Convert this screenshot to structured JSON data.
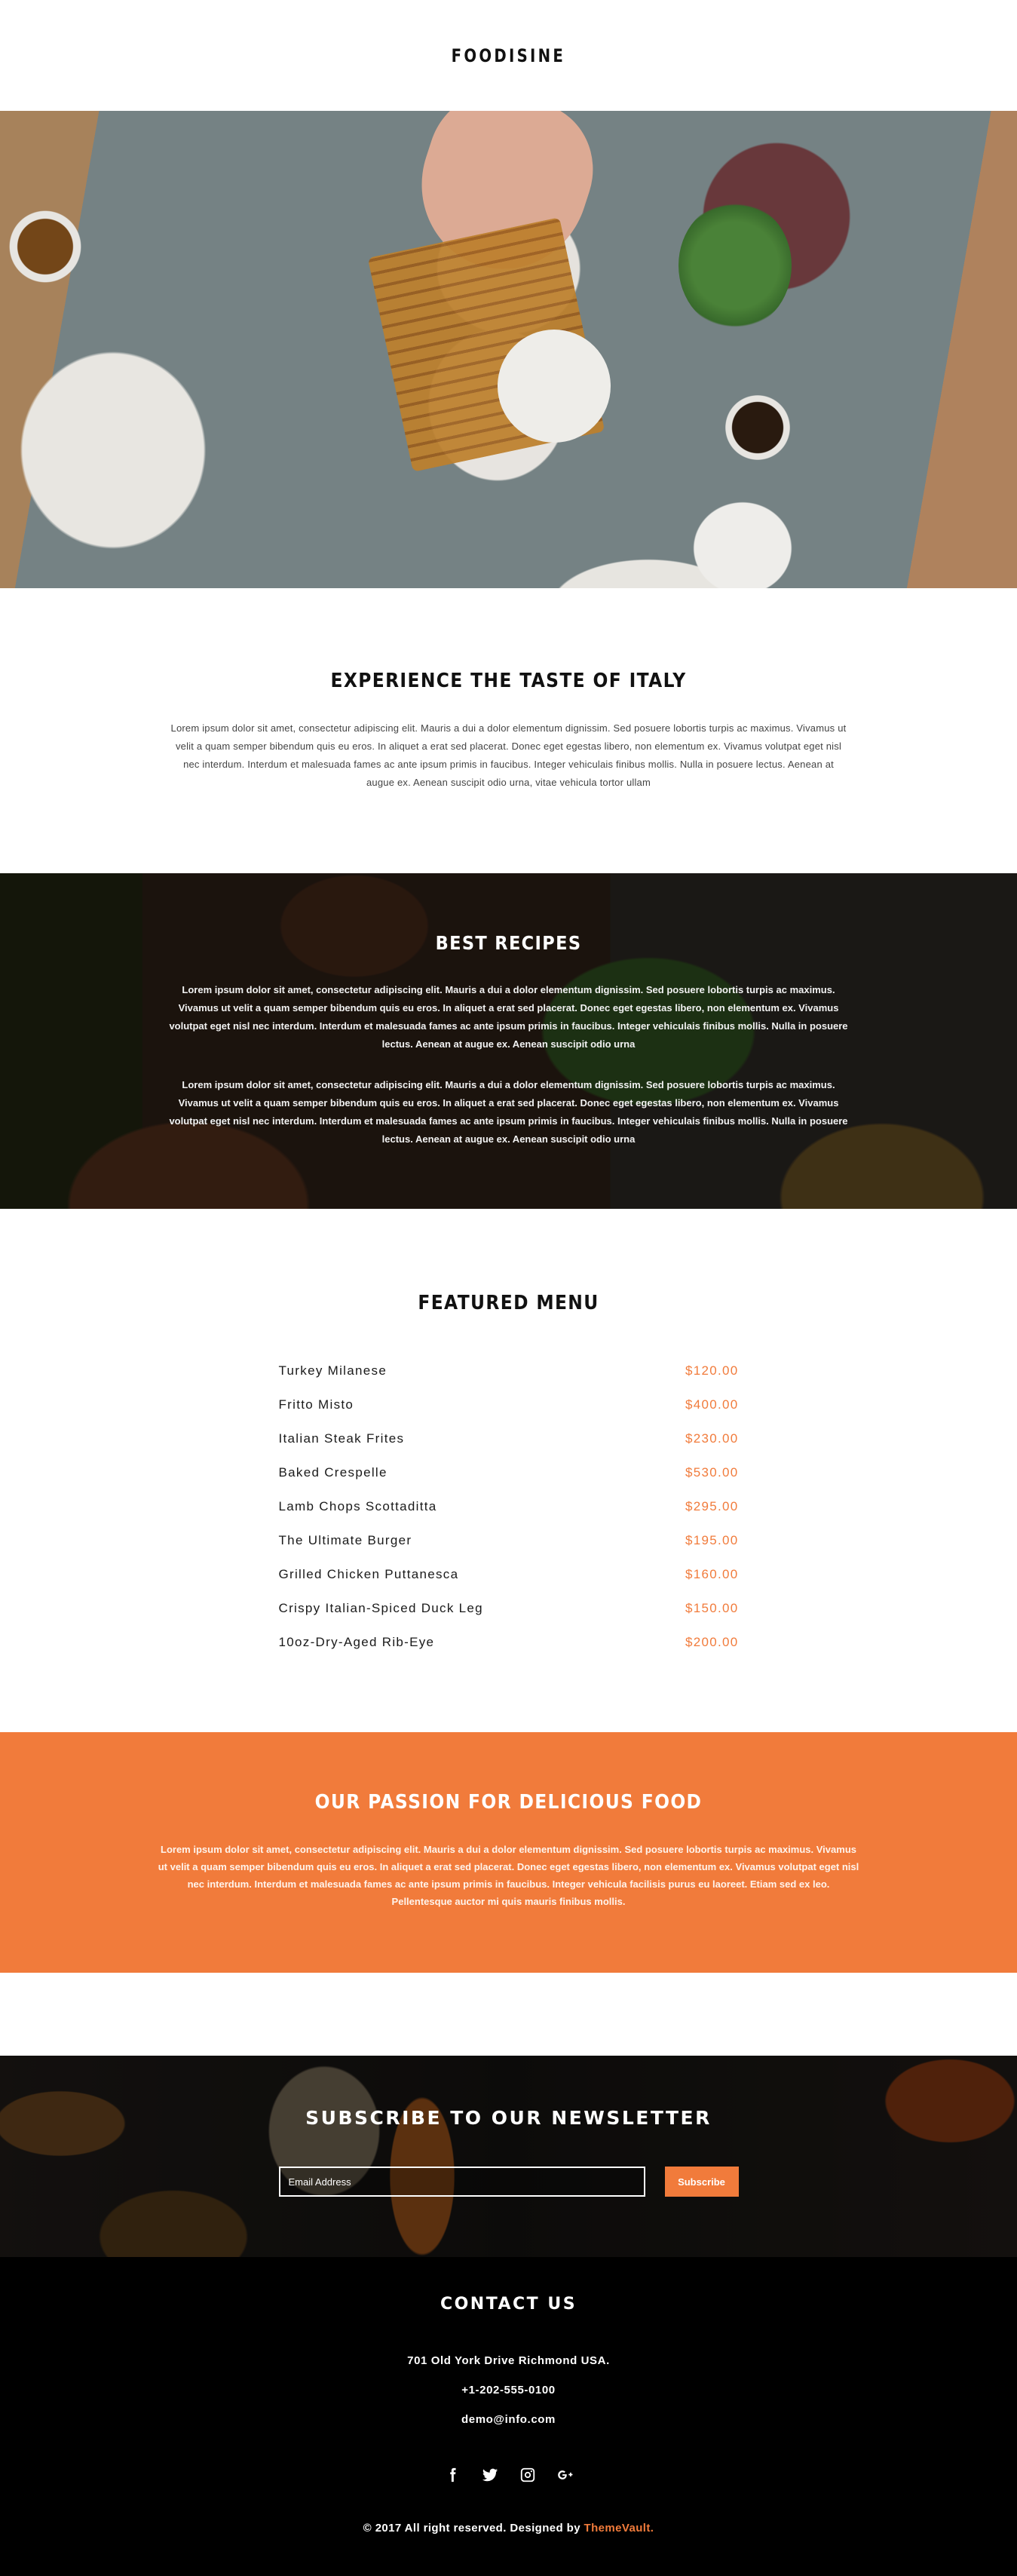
{
  "header": {
    "logo": "FOODISINE"
  },
  "intro": {
    "title": "EXPERIENCE THE TASTE OF ITALY",
    "body": "Lorem ipsum dolor sit amet, consectetur adipiscing elit. Mauris a dui a dolor elementum dignissim. Sed posuere lobortis turpis ac maximus. Vivamus ut velit a quam semper bibendum quis eu eros. In aliquet a erat sed placerat. Donec eget egestas libero, non elementum ex. Vivamus volutpat eget nisl nec interdum. Interdum et malesuada fames ac ante ipsum primis in faucibus. Integer vehiculais finibus mollis. Nulla in posuere lectus. Aenean at augue ex. Aenean suscipit odio urna, vitae vehicula tortor ullam"
  },
  "recipes": {
    "title": "BEST RECIPES",
    "paragraphs": [
      "Lorem ipsum dolor sit amet, consectetur adipiscing elit. Mauris a dui a dolor elementum dignissim. Sed posuere lobortis turpis ac maximus. Vivamus ut velit a quam semper bibendum quis eu eros. In aliquet a erat sed placerat. Donec eget egestas libero, non elementum ex. Vivamus volutpat eget nisl nec interdum. Interdum et malesuada fames ac ante ipsum primis in faucibus. Integer vehiculais finibus mollis. Nulla in posuere lectus. Aenean at augue ex. Aenean suscipit odio urna",
      "Lorem ipsum dolor sit amet, consectetur adipiscing elit. Mauris a dui a dolor elementum dignissim. Sed posuere lobortis turpis ac maximus. Vivamus ut velit a quam semper bibendum quis eu eros. In aliquet a erat sed placerat. Donec eget egestas libero, non elementum ex. Vivamus volutpat eget nisl nec interdum. Interdum et malesuada fames ac ante ipsum primis in faucibus. Integer vehiculais finibus mollis. Nulla in posuere lectus. Aenean at augue ex. Aenean suscipit odio urna"
    ]
  },
  "menu": {
    "title": "FEATURED MENU",
    "items": [
      {
        "name": "Turkey Milanese",
        "price": "$120.00"
      },
      {
        "name": "Fritto Misto",
        "price": "$400.00"
      },
      {
        "name": "Italian Steak Frites",
        "price": "$230.00"
      },
      {
        "name": "Baked Crespelle",
        "price": "$530.00"
      },
      {
        "name": "Lamb Chops Scottaditta",
        "price": "$295.00"
      },
      {
        "name": "The Ultimate Burger",
        "price": "$195.00"
      },
      {
        "name": "Grilled Chicken Puttanesca",
        "price": "$160.00"
      },
      {
        "name": "Crispy Italian-Spiced Duck Leg",
        "price": "$150.00"
      },
      {
        "name": "10oz-Dry-Aged Rib-Eye",
        "price": "$200.00"
      }
    ]
  },
  "passion": {
    "title": "OUR PASSION FOR DELICIOUS FOOD",
    "body": "Lorem ipsum dolor sit amet, consectetur adipiscing elit. Mauris a dui a dolor elementum dignissim. Sed posuere lobortis turpis ac maximus. Vivamus ut velit a quam semper bibendum quis eu eros. In aliquet a erat sed placerat. Donec eget egestas libero, non elementum ex. Vivamus volutpat eget nisl nec interdum. Interdum et malesuada fames ac ante ipsum primis in faucibus. Integer vehicula facilisis purus eu laoreet. Etiam sed ex leo. Pellentesque auctor mi quis mauris finibus mollis."
  },
  "newsletter": {
    "title": "SUBSCRIBE TO OUR NEWSLETTER",
    "email_placeholder": "Email Address",
    "email_value": "",
    "subscribe_label": "Subscribe"
  },
  "footer": {
    "title": "CONTACT US",
    "address": "701 Old York Drive Richmond USA.",
    "phone": "+1-202-555-0100",
    "email": "demo@info.com",
    "social": [
      "facebook-icon",
      "twitter-icon",
      "instagram-icon",
      "google-plus-icon"
    ],
    "copyright_text": "© 2017 All right reserved. Designed by ",
    "designer": "ThemeVault."
  },
  "colors": {
    "accent": "#f17b3b",
    "footer_bg": "#000000",
    "text_dark": "#111111"
  }
}
